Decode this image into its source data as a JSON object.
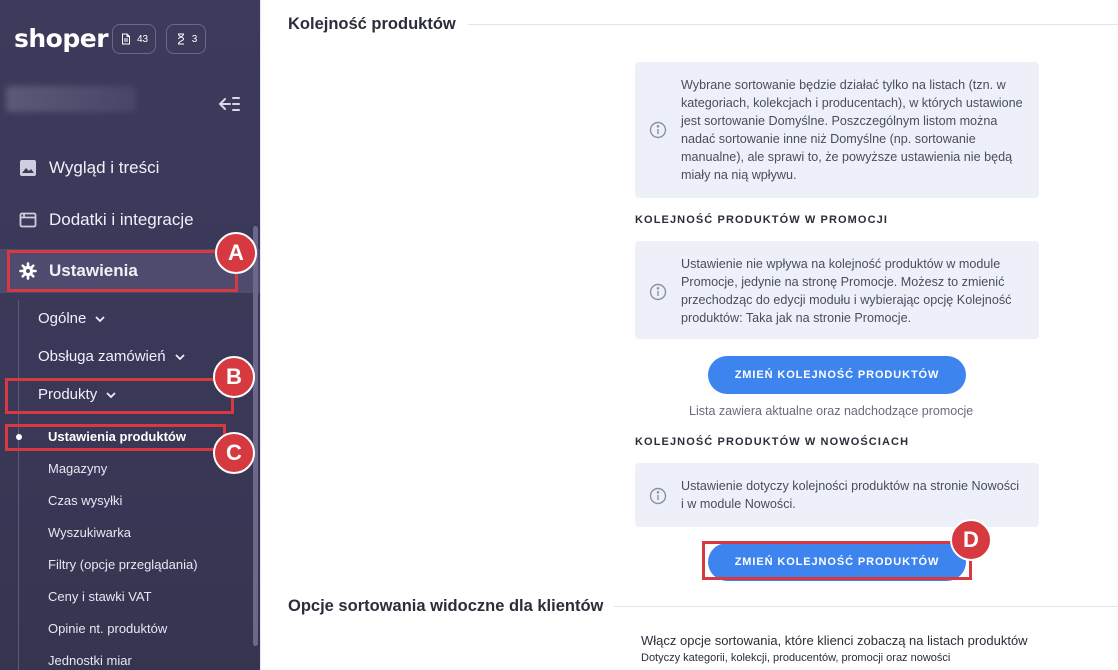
{
  "sidebar": {
    "logo": "shoper",
    "counters": [
      {
        "icon": "document-icon",
        "value": "43"
      },
      {
        "icon": "hourglass-icon",
        "value": "3"
      }
    ],
    "nav": {
      "looks": "Wygląd i treści",
      "addons": "Dodatki i integracje",
      "settings": "Ustawienia"
    },
    "sub": {
      "general": "Ogólne",
      "orders": "Obsługa zamówień",
      "products": "Produkty"
    },
    "leaves": [
      "Ustawienia produktów",
      "Magazyny",
      "Czas wysyłki",
      "Wyszukiwarka",
      "Filtry (opcje przeglądania)",
      "Ceny i stawki VAT",
      "Opinie nt. produktów",
      "Jednostki miar"
    ]
  },
  "annotations": {
    "a": "A",
    "b": "B",
    "c": "C",
    "d": "D",
    "color": "#d63a40"
  },
  "main": {
    "section1_title": "Kolejność produktów",
    "info1": "Wybrane sortowanie będzie działać tylko na listach (tzn. w kategoriach, kolekcjach i producentach), w których ustawione jest sortowanie Domyślne. Poszczególnym listom można nadać sortowanie inne niż Domyślne (np. sortowanie manualne), ale sprawi to, że powyższe ustawienia nie będą miały na nią wpływu.",
    "promo_heading": "KOLEJNOŚĆ PRODUKTÓW W PROMOCJI",
    "info2": "Ustawienie nie wpływa na kolejność produktów w module Promocje, jedynie na stronę Promocje. Możesz to zmienić przechodząc do edycji modułu i wybierając opcję Kolejność produktów: Taka jak na stronie Promocje.",
    "button_label": "ZMIEŃ KOLEJNOŚĆ PRODUKTÓW",
    "promo_note": "Lista zawiera aktualne oraz nadchodzące promocje",
    "news_heading": "KOLEJNOŚĆ PRODUKTÓW W NOWOŚCIACH",
    "info3": "Ustawienie dotyczy kolejności produktów na stronie Nowości i w module Nowości.",
    "section2_title": "Opcje sortowania widoczne dla klientów",
    "sort_desc": "Włącz opcje sortowania, które klienci zobaczą na listach produktów",
    "sort_sub": "Dotyczy kategorii, kolekcji, producentów, promocji oraz nowości"
  },
  "colors": {
    "sidebar_bg": "#3d3a5c",
    "accent_button": "#3d84ee",
    "info_bg": "#edf0f8"
  }
}
